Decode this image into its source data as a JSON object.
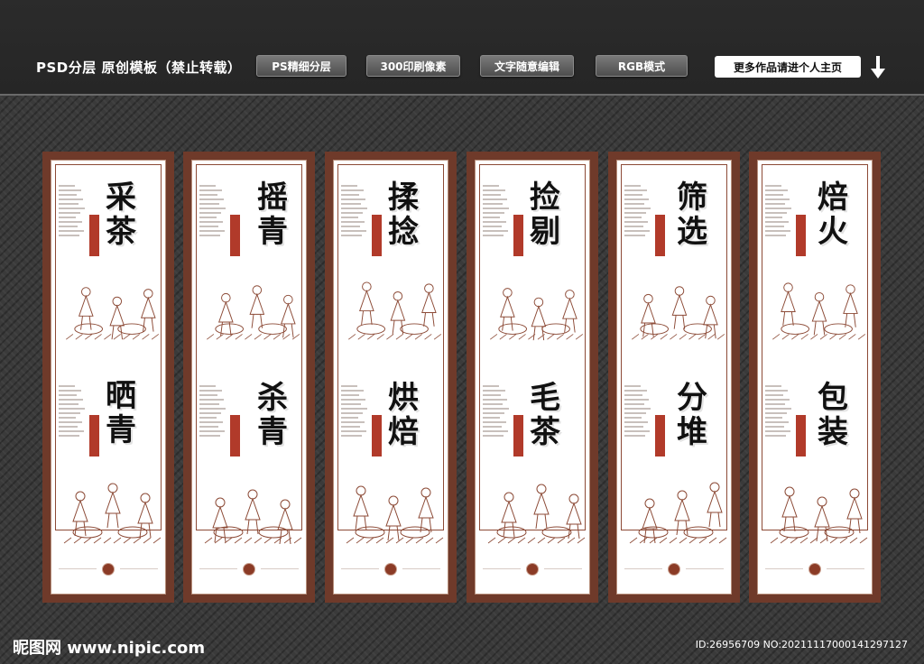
{
  "header": {
    "title": "PSD分层 原创模板（禁止转载）",
    "badges": [
      "PS精细分层",
      "300印刷像素",
      "文字随意编辑",
      "RGB模式"
    ],
    "more_link": "更多作品请进个人主页",
    "arrow_icon": "arrow-down-icon"
  },
  "panels": [
    {
      "top": "采茶",
      "bottom": "晒青"
    },
    {
      "top": "摇青",
      "bottom": "杀青"
    },
    {
      "top": "揉捻",
      "bottom": "烘焙"
    },
    {
      "top": "捡剔",
      "bottom": "毛茶"
    },
    {
      "top": "筛选",
      "bottom": "分堆"
    },
    {
      "top": "焙火",
      "bottom": "包装"
    }
  ],
  "colors": {
    "frame": "#6f3a2a",
    "seal": "#b13a2a",
    "ink": "#111111"
  },
  "watermark": {
    "left": "昵图网 www.nipic.com",
    "right": "ID:26956709 NO:20211117000141297127"
  }
}
